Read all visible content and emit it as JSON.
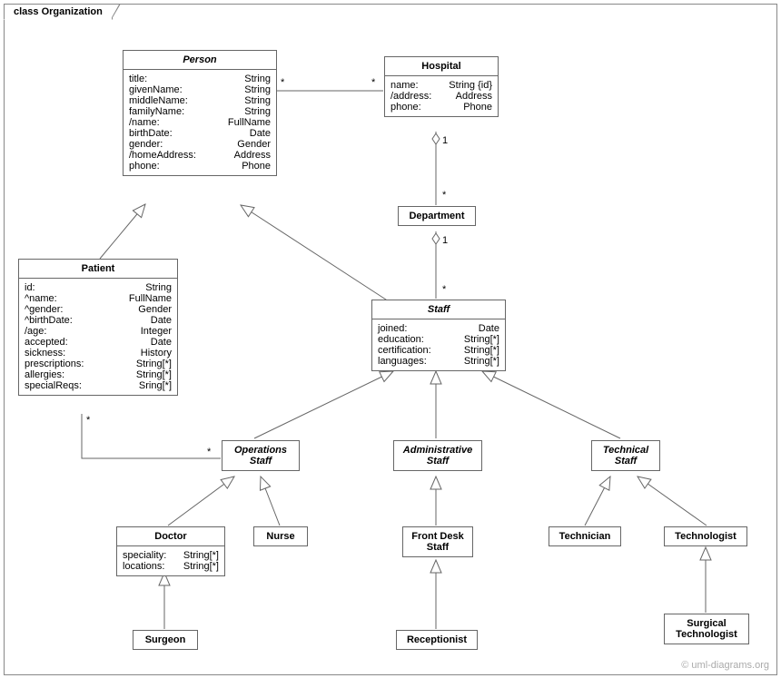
{
  "frame": {
    "title": "class Organization"
  },
  "watermark": "© uml-diagrams.org",
  "classes": {
    "person": {
      "name": "Person",
      "attrs": [
        [
          "title:",
          "String"
        ],
        [
          "givenName:",
          "String"
        ],
        [
          "middleName:",
          "String"
        ],
        [
          "familyName:",
          "String"
        ],
        [
          "/name:",
          "FullName"
        ],
        [
          "birthDate:",
          "Date"
        ],
        [
          "gender:",
          "Gender"
        ],
        [
          "/homeAddress:",
          "Address"
        ],
        [
          "phone:",
          "Phone"
        ]
      ]
    },
    "hospital": {
      "name": "Hospital",
      "attrs": [
        [
          "name:",
          "String {id}"
        ],
        [
          "/address:",
          "Address"
        ],
        [
          "phone:",
          "Phone"
        ]
      ]
    },
    "department": {
      "name": "Department",
      "attrs": []
    },
    "patient": {
      "name": "Patient",
      "attrs": [
        [
          "id:",
          "String"
        ],
        [
          "^name:",
          "FullName"
        ],
        [
          "^gender:",
          "Gender"
        ],
        [
          "^birthDate:",
          "Date"
        ],
        [
          "/age:",
          "Integer"
        ],
        [
          "accepted:",
          "Date"
        ],
        [
          "sickness:",
          "History"
        ],
        [
          "prescriptions:",
          "String[*]"
        ],
        [
          "allergies:",
          "String[*]"
        ],
        [
          "specialReqs:",
          "Sring[*]"
        ]
      ]
    },
    "staff": {
      "name": "Staff",
      "attrs": [
        [
          "joined:",
          "Date"
        ],
        [
          "education:",
          "String[*]"
        ],
        [
          "certification:",
          "String[*]"
        ],
        [
          "languages:",
          "String[*]"
        ]
      ]
    },
    "opsStaff": {
      "name": "Operations\nStaff",
      "attrs": []
    },
    "adminStaff": {
      "name": "Administrative\nStaff",
      "attrs": []
    },
    "techStaff": {
      "name": "Technical\nStaff",
      "attrs": []
    },
    "doctor": {
      "name": "Doctor",
      "attrs": [
        [
          "speciality:",
          "String[*]"
        ],
        [
          "locations:",
          "String[*]"
        ]
      ]
    },
    "nurse": {
      "name": "Nurse",
      "attrs": []
    },
    "frontDesk": {
      "name": "Front Desk\nStaff",
      "attrs": []
    },
    "technician": {
      "name": "Technician",
      "attrs": []
    },
    "technologist": {
      "name": "Technologist",
      "attrs": []
    },
    "surgeon": {
      "name": "Surgeon",
      "attrs": []
    },
    "receptionist": {
      "name": "Receptionist",
      "attrs": []
    },
    "surgTech": {
      "name": "Surgical\nTechnologist",
      "attrs": []
    }
  },
  "mults": {
    "personHospL": "*",
    "personHospR": "*",
    "hospDeptT": "1",
    "hospDeptB": "*",
    "deptStaffT": "1",
    "deptStaffB": "*",
    "patOpsL": "*",
    "patOpsR": "*"
  }
}
